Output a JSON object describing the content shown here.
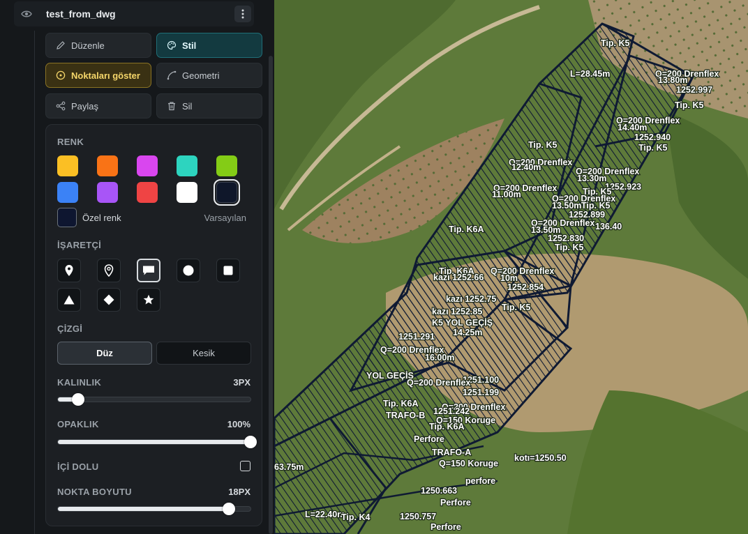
{
  "layer": {
    "title": "test_from_dwg",
    "eye_icon": "eye-icon",
    "menu_icon": "kebab-menu-icon"
  },
  "actions": {
    "edit": "Düzenle",
    "style": "Stil",
    "show_points": "Noktaları göster",
    "geometry": "Geometri",
    "share": "Paylaş",
    "delete": "Sil"
  },
  "color_section": {
    "label": "RENK",
    "swatches": [
      "#fbbf24",
      "#f97316",
      "#d946ef",
      "#2dd4bf",
      "#84cc16",
      "#3b82f6",
      "#a855f7",
      "#ef4444",
      "#ffffff",
      "#0f172a"
    ],
    "selected_index": 9,
    "custom_label": "Özel renk",
    "default_label": "Varsayılan"
  },
  "marker_section": {
    "label": "İŞARETÇİ",
    "icons": [
      "map-pin-filled-icon",
      "map-pin-outline-icon",
      "speech-bubble-icon",
      "circle-icon",
      "square-icon",
      "triangle-icon",
      "diamond-icon",
      "star-icon"
    ],
    "selected_index": 2
  },
  "line_section": {
    "label": "ÇİZGİ",
    "solid": "Düz",
    "dashed": "Kesik",
    "selected": "solid"
  },
  "thickness": {
    "label": "KALINLIK",
    "value_text": "3PX",
    "value": 3,
    "min": 1,
    "max": 20
  },
  "opacity": {
    "label": "OPAKLIK",
    "value_text": "100%",
    "value": 100,
    "min": 0,
    "max": 100
  },
  "fill": {
    "label": "İÇİ DOLU",
    "checked": false
  },
  "point_size": {
    "label": "NOKTA BOYUTU",
    "value_text": "18PX",
    "value": 18,
    "min": 2,
    "max": 20
  },
  "map_labels": [
    "Tip. K5",
    "L=28.45m",
    "Q=200 Drenflex",
    "13.80m",
    "1252.997",
    "Tip. K5",
    "Q=200 Drenflex",
    "14.40m",
    "1252.940",
    "Tip. K5",
    "Tip. K5",
    "Q=200 Drenflex",
    "12.40m",
    "Q=200 Drenflex",
    "13.30m",
    "1252.923",
    "Tip. K5",
    "Q=200 Drenflex",
    "11.00m",
    "Q=200 Drenflex",
    "13.50m",
    "Tip. K5",
    "1252.899",
    "Tip. K6A",
    "Q=200 Drenflex",
    "13.50m",
    "136.40",
    "1252.830",
    "Tip. K5",
    "Tip. K6A",
    "Q=200 Drenflex",
    "kazı 1252.66",
    "10m",
    "1252.854",
    "kazı 1252.75",
    "kazı 1252.85",
    "Tip. K5",
    "K5 YOL GEÇİŞ",
    "1251.291",
    "14.25m",
    "Q=200 Drenflex",
    "16.00m",
    "1251.100",
    "YOL GEÇİŞ",
    "Q=200 Drenflex",
    "1251.199",
    "Tip. K6A",
    "Q=200 Drenflex",
    "TRAFO-B",
    "1251.242",
    "Q=150 Koruge",
    "Tip. K6A",
    "Perfore",
    "TRAFO-A",
    "kotı=1250.50",
    "Q=150 Koruge",
    "1250.663",
    "perfore",
    "Perfore",
    "1250.757",
    "Perfore",
    "63.75m",
    "L=22.40m",
    "Tip. K4"
  ]
}
